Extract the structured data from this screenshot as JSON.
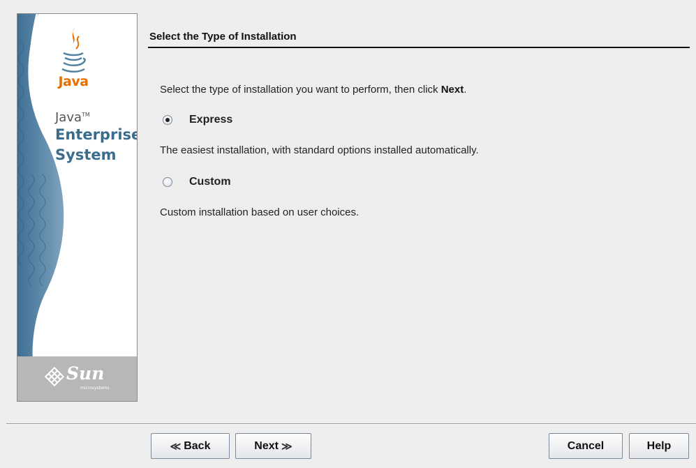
{
  "sidebar": {
    "java_logo_text": "Java",
    "product_line1": "Java",
    "product_tm": "TM",
    "product_line2": "Enterprise",
    "product_line3": "System",
    "vendor_name": "Sun",
    "vendor_sub": "microsystems"
  },
  "header": {
    "title": "Select the Type of Installation"
  },
  "main": {
    "instruction_prefix": "Select the type of installation you want to perform, then click ",
    "instruction_bold": "Next",
    "instruction_suffix": ".",
    "options": [
      {
        "label": "Express",
        "selected": true,
        "description": "The easiest installation, with standard options installed automatically."
      },
      {
        "label": "Custom",
        "selected": false,
        "description": "Custom installation based on user choices."
      }
    ]
  },
  "footer": {
    "back_label": "Back",
    "next_label": "Next",
    "cancel_label": "Cancel",
    "help_label": "Help"
  },
  "colors": {
    "java_orange": "#e76f00",
    "product_blue": "#3a6d8d",
    "wave_blue": "#4f7ea0",
    "background": "#eeeeee"
  }
}
